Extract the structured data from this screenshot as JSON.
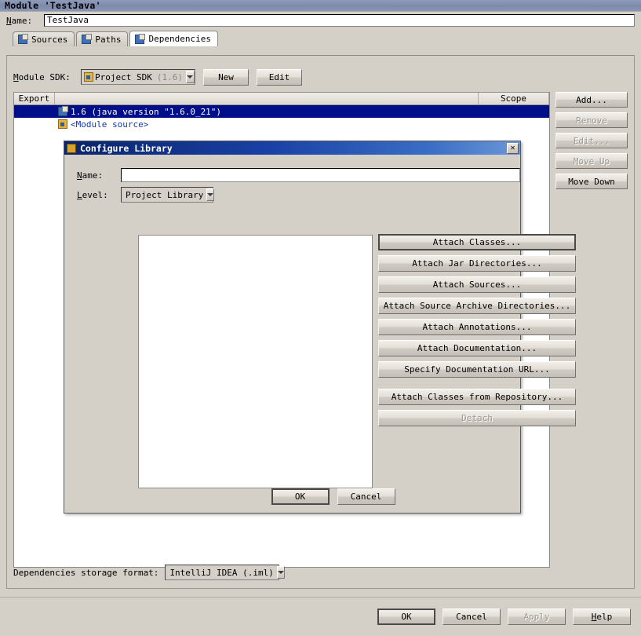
{
  "window": {
    "title": "Module 'TestJava'"
  },
  "name_field": {
    "label": "Name:",
    "value": "TestJava"
  },
  "tabs": [
    {
      "label": "Sources",
      "icon": "sources-icon",
      "active": false
    },
    {
      "label": "Paths",
      "icon": "paths-icon",
      "active": false
    },
    {
      "label": "Dependencies",
      "icon": "dependencies-icon",
      "active": true
    }
  ],
  "sdk_row": {
    "label": "Module SDK:",
    "combo_value": "Project SDK",
    "combo_version": "(1.6)",
    "new_button": "New",
    "edit_button": "Edit"
  },
  "dependencies_table": {
    "columns": [
      "Export",
      "",
      "Scope"
    ],
    "rows": [
      {
        "icon": "sdk-icon",
        "label": "1.6 (java version \"1.6.0_21\")",
        "selected": true,
        "scope": ""
      },
      {
        "icon": "folder-icon",
        "label": "<Module source>",
        "selected": false,
        "scope": ""
      }
    ]
  },
  "side_buttons": [
    {
      "label": "Add...",
      "enabled": true
    },
    {
      "label": "Remove",
      "enabled": false
    },
    {
      "label": "Edit...",
      "enabled": false
    },
    {
      "label": "Move Up",
      "enabled": false
    },
    {
      "label": "Move Down",
      "enabled": true
    }
  ],
  "storage_format": {
    "label": "Dependencies storage format:",
    "value": "IntelliJ IDEA (.iml)"
  },
  "bottom_buttons": [
    {
      "label": "OK",
      "enabled": true,
      "default": true
    },
    {
      "label": "Cancel",
      "enabled": true,
      "default": false
    },
    {
      "label": "Apply",
      "enabled": false,
      "default": false
    },
    {
      "label": "Help",
      "enabled": true,
      "default": false
    }
  ],
  "dialog": {
    "title": "Configure Library",
    "close_label": "✕",
    "name_label": "Name:",
    "name_value": "",
    "level_label": "Level:",
    "level_value": "Project Library",
    "attach_buttons": [
      {
        "label": "Attach Classes...",
        "enabled": true,
        "default": true,
        "gap": false
      },
      {
        "label": "Attach Jar Directories...",
        "enabled": true,
        "default": false,
        "gap": false
      },
      {
        "label": "Attach Sources...",
        "enabled": true,
        "default": false,
        "gap": false
      },
      {
        "label": "Attach Source Archive Directories...",
        "enabled": true,
        "default": false,
        "gap": false
      },
      {
        "label": "Attach Annotations...",
        "enabled": true,
        "default": false,
        "gap": false
      },
      {
        "label": "Attach Documentation...",
        "enabled": true,
        "default": false,
        "gap": false
      },
      {
        "label": "Specify Documentation URL...",
        "enabled": true,
        "default": false,
        "gap": false
      },
      {
        "label": "Attach Classes from Repository...",
        "enabled": true,
        "default": false,
        "gap": true
      },
      {
        "label": "Detach",
        "enabled": false,
        "default": false,
        "gap": false
      }
    ],
    "ok_label": "OK",
    "cancel_label": "Cancel"
  },
  "colors": {
    "window_title_bar": "#7d8aaa",
    "dialog_title_start": "#0a246a",
    "dialog_title_end": "#6a97d8",
    "selection": "#000e8a",
    "panel_bg": "#d4d0c8",
    "module_source_text": "#1338b0"
  }
}
